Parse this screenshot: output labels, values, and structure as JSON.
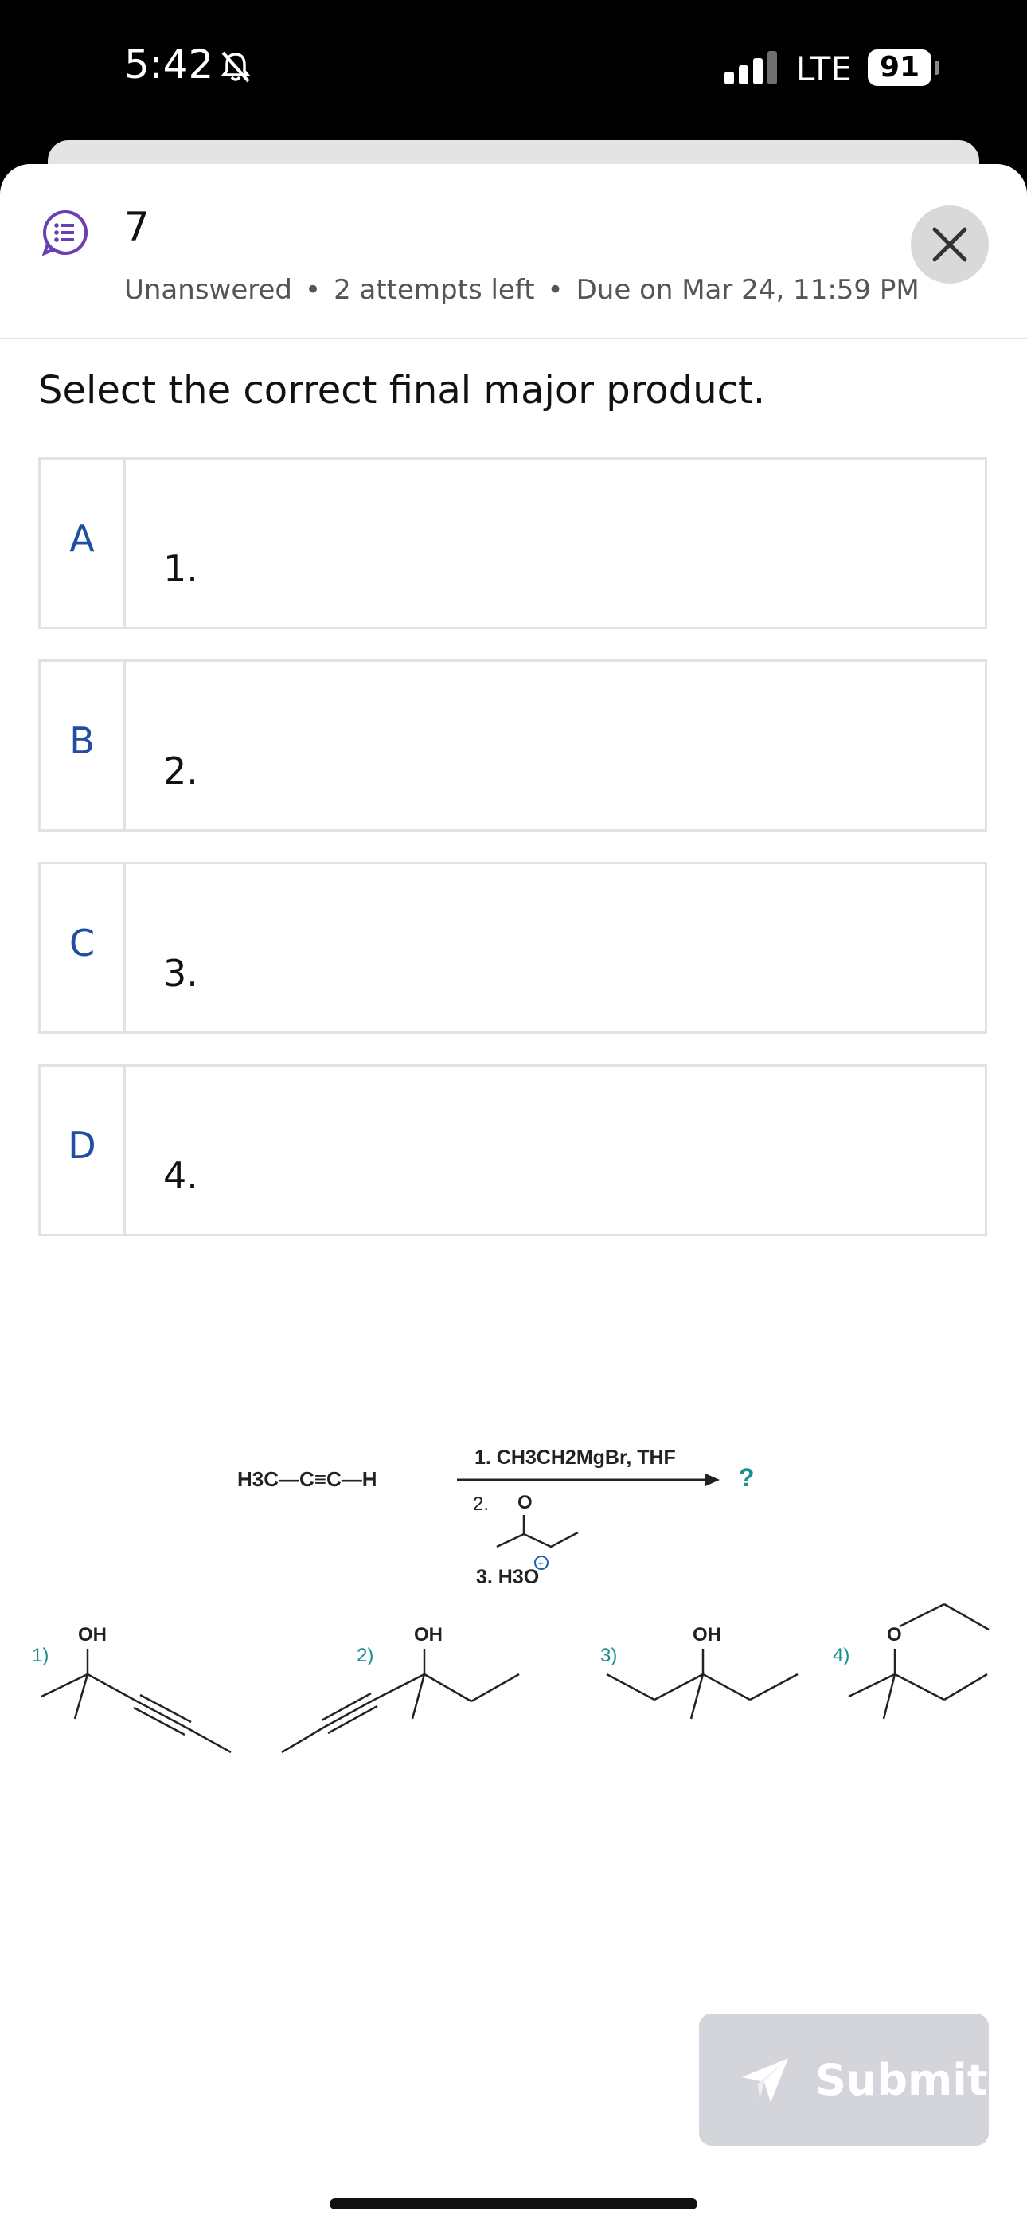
{
  "status_bar": {
    "time": "5:42",
    "network": "LTE",
    "battery": "91"
  },
  "question": {
    "number": "7",
    "status": "Unanswered",
    "attempts": "2 attempts left",
    "due": "Due on Mar 24, 11:59 PM",
    "prompt": "Select the correct final major product."
  },
  "options": [
    {
      "letter": "A",
      "label": "1."
    },
    {
      "letter": "B",
      "label": "2."
    },
    {
      "letter": "C",
      "label": "3."
    },
    {
      "letter": "D",
      "label": "4."
    }
  ],
  "figure": {
    "reactant": "H3C—C≡C—H",
    "steps": [
      "1. CH3CH2MgBr, THF",
      "2.",
      "3. H3O"
    ],
    "step2_atom": "O",
    "unknown": "?",
    "choice_labels": [
      "1)",
      "2)",
      "3)",
      "4)"
    ],
    "atom_labels": [
      "OH",
      "OH",
      "OH",
      "O"
    ]
  },
  "submit": {
    "label": "Submit"
  },
  "colors": {
    "accent": "#1f4fa0",
    "teal": "#1a8f8f",
    "icon_purple": "#6a3fb5",
    "submit_bg": "#d3d5db"
  }
}
